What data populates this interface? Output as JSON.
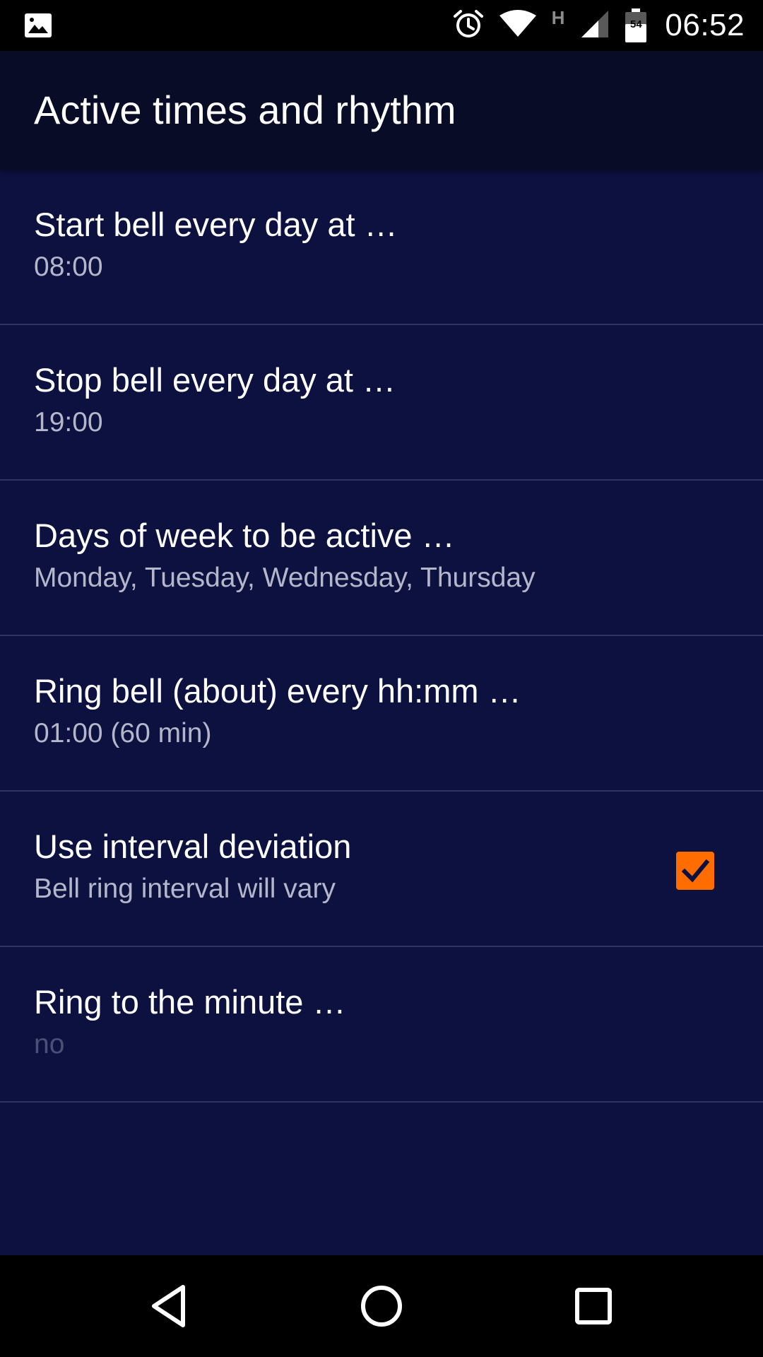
{
  "status_bar": {
    "time": "06:52",
    "network_type": "H",
    "battery_level": "54",
    "icons": [
      "image-icon",
      "alarm-icon",
      "wifi-icon",
      "signal-icon",
      "battery-icon"
    ]
  },
  "app_bar": {
    "title": "Active times and rhythm"
  },
  "preferences": [
    {
      "title": "Start bell every day at …",
      "summary": "08:00"
    },
    {
      "title": "Stop bell every day at …",
      "summary": "19:00"
    },
    {
      "title": "Days of week to be active …",
      "summary": "Monday, Tuesday, Wednesday, Thursday"
    },
    {
      "title": "Ring bell (about) every hh:mm …",
      "summary": "01:00 (60 min)"
    },
    {
      "title": "Use interval deviation",
      "summary": "Bell ring interval will vary",
      "checked": true
    },
    {
      "title": "Ring to the minute …",
      "summary": "no",
      "summary_disabled": true
    }
  ],
  "nav_bar": {
    "buttons": [
      "back-icon",
      "home-icon",
      "recents-icon"
    ]
  },
  "colors": {
    "background": "#0d1140",
    "app_bar": "#080c26",
    "divider": "#2e3563",
    "accent": "#ff6d00",
    "summary_text": "#b3b7c9",
    "disabled_text": "#4a5078"
  }
}
